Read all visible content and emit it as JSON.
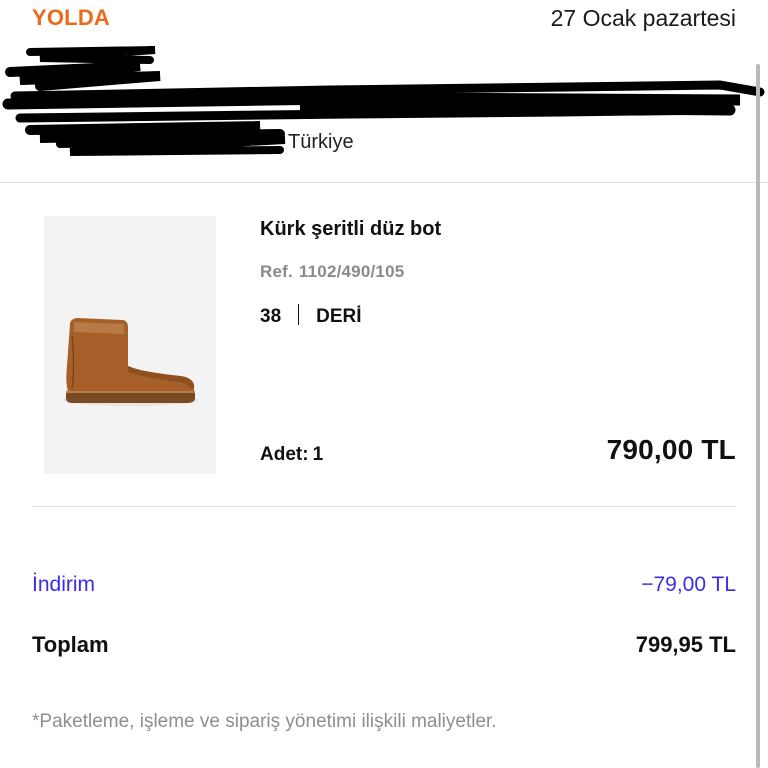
{
  "header": {
    "status": "YOLDA",
    "date": "27 Ocak pazartesi"
  },
  "address": {
    "country": "Türkiye"
  },
  "product": {
    "name": "Kürk şeritli düz bot",
    "ref_prefix": "Ref.",
    "ref": "1102/490/105",
    "size": "38",
    "material": "DERİ",
    "quantity_label": "Adet:",
    "quantity": "1",
    "price": "790,00 TL"
  },
  "summary": {
    "discount_label": "İndirim",
    "discount_value": "−79,00 TL",
    "total_label": "Toplam",
    "total_value": "799,95 TL"
  },
  "footnote": "*Paketleme, işleme ve sipariş yönetimi ilişkili maliyetler.",
  "colors": {
    "status": "#ec6a1c",
    "discount": "#3a2ee0",
    "muted": "#8a8a8a"
  }
}
